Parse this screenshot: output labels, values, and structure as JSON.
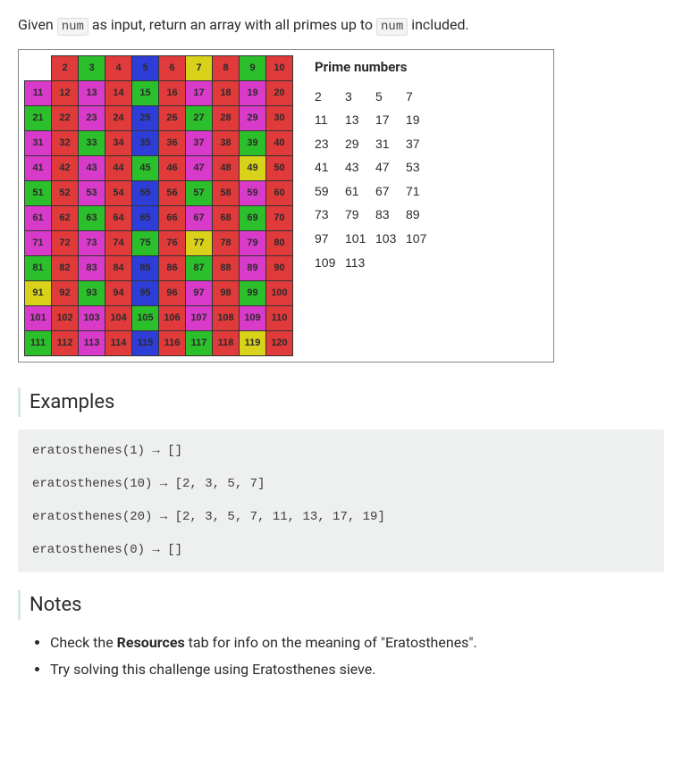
{
  "prompt": {
    "before": "Given ",
    "code1": "num",
    "mid": " as input, return an array with all primes up to ",
    "code2": "num",
    "after": " included."
  },
  "sieve": {
    "rows": [
      [
        null,
        2,
        3,
        4,
        5,
        6,
        7,
        8,
        9,
        10
      ],
      [
        11,
        12,
        13,
        14,
        15,
        16,
        17,
        18,
        19,
        20
      ],
      [
        21,
        22,
        23,
        24,
        25,
        26,
        27,
        28,
        29,
        30
      ],
      [
        31,
        32,
        33,
        34,
        35,
        36,
        37,
        38,
        39,
        40
      ],
      [
        41,
        42,
        43,
        44,
        45,
        46,
        47,
        48,
        49,
        50
      ],
      [
        51,
        52,
        53,
        54,
        55,
        56,
        57,
        58,
        59,
        60
      ],
      [
        61,
        62,
        63,
        64,
        65,
        66,
        67,
        68,
        69,
        70
      ],
      [
        71,
        72,
        73,
        74,
        75,
        76,
        77,
        78,
        79,
        80
      ],
      [
        81,
        82,
        83,
        84,
        85,
        86,
        87,
        88,
        89,
        90
      ],
      [
        91,
        92,
        93,
        94,
        95,
        96,
        97,
        98,
        99,
        100
      ],
      [
        101,
        102,
        103,
        104,
        105,
        106,
        107,
        108,
        109,
        110
      ],
      [
        111,
        112,
        113,
        114,
        115,
        116,
        117,
        118,
        119,
        120
      ]
    ],
    "colors": {
      "2": "red",
      "3": "green",
      "4": "red",
      "5": "blue",
      "6": "red",
      "7": "yellow",
      "8": "red",
      "9": "green",
      "10": "red",
      "11": "pink",
      "12": "red",
      "13": "pink",
      "14": "red",
      "15": "green",
      "16": "red",
      "17": "pink",
      "18": "red",
      "19": "pink",
      "20": "red",
      "21": "green",
      "22": "red",
      "23": "pink",
      "24": "red",
      "25": "blue",
      "26": "red",
      "27": "green",
      "28": "red",
      "29": "pink",
      "30": "red",
      "31": "pink",
      "32": "red",
      "33": "green",
      "34": "red",
      "35": "blue",
      "36": "red",
      "37": "pink",
      "38": "red",
      "39": "green",
      "40": "red",
      "41": "pink",
      "42": "red",
      "43": "pink",
      "44": "red",
      "45": "green",
      "46": "red",
      "47": "pink",
      "48": "red",
      "49": "yellow",
      "50": "red",
      "51": "green",
      "52": "red",
      "53": "pink",
      "54": "red",
      "55": "blue",
      "56": "red",
      "57": "green",
      "58": "red",
      "59": "pink",
      "60": "red",
      "61": "pink",
      "62": "red",
      "63": "green",
      "64": "red",
      "65": "blue",
      "66": "red",
      "67": "pink",
      "68": "red",
      "69": "green",
      "70": "red",
      "71": "pink",
      "72": "red",
      "73": "pink",
      "74": "red",
      "75": "green",
      "76": "red",
      "77": "yellow",
      "78": "red",
      "79": "pink",
      "80": "red",
      "81": "green",
      "82": "red",
      "83": "pink",
      "84": "red",
      "85": "blue",
      "86": "red",
      "87": "green",
      "88": "red",
      "89": "pink",
      "90": "red",
      "91": "yellow",
      "92": "red",
      "93": "green",
      "94": "red",
      "95": "blue",
      "96": "red",
      "97": "pink",
      "98": "red",
      "99": "green",
      "100": "red",
      "101": "pink",
      "102": "red",
      "103": "pink",
      "104": "red",
      "105": "green",
      "106": "red",
      "107": "pink",
      "108": "red",
      "109": "pink",
      "110": "red",
      "111": "green",
      "112": "red",
      "113": "pink",
      "114": "red",
      "115": "blue",
      "116": "red",
      "117": "green",
      "118": "red",
      "119": "yellow",
      "120": "red"
    }
  },
  "primes": {
    "title": "Prime numbers",
    "rows": [
      [
        "2",
        "3",
        "5",
        "7"
      ],
      [
        "11",
        "13",
        "17",
        "19"
      ],
      [
        "23",
        "29",
        "31",
        "37"
      ],
      [
        "41",
        "43",
        "47",
        "53"
      ],
      [
        "59",
        "61",
        "67",
        "71"
      ],
      [
        "73",
        "79",
        "83",
        "89"
      ],
      [
        "97",
        "101",
        "103",
        "107"
      ],
      [
        "109",
        "113",
        "",
        ""
      ]
    ]
  },
  "sections": {
    "examples_heading": "Examples",
    "notes_heading": "Notes"
  },
  "examples": [
    "eratosthenes(1) → []",
    "eratosthenes(10) → [2, 3, 5, 7]",
    "eratosthenes(20) → [2, 3, 5, 7, 11, 13, 17, 19]",
    "eratosthenes(0) → []"
  ],
  "notes": [
    {
      "before": "Check the ",
      "bold": "Resources",
      "after": " tab for info on the meaning of \"Eratosthenes\"."
    },
    {
      "before": "Try solving this challenge using Eratosthenes sieve.",
      "bold": "",
      "after": ""
    }
  ]
}
